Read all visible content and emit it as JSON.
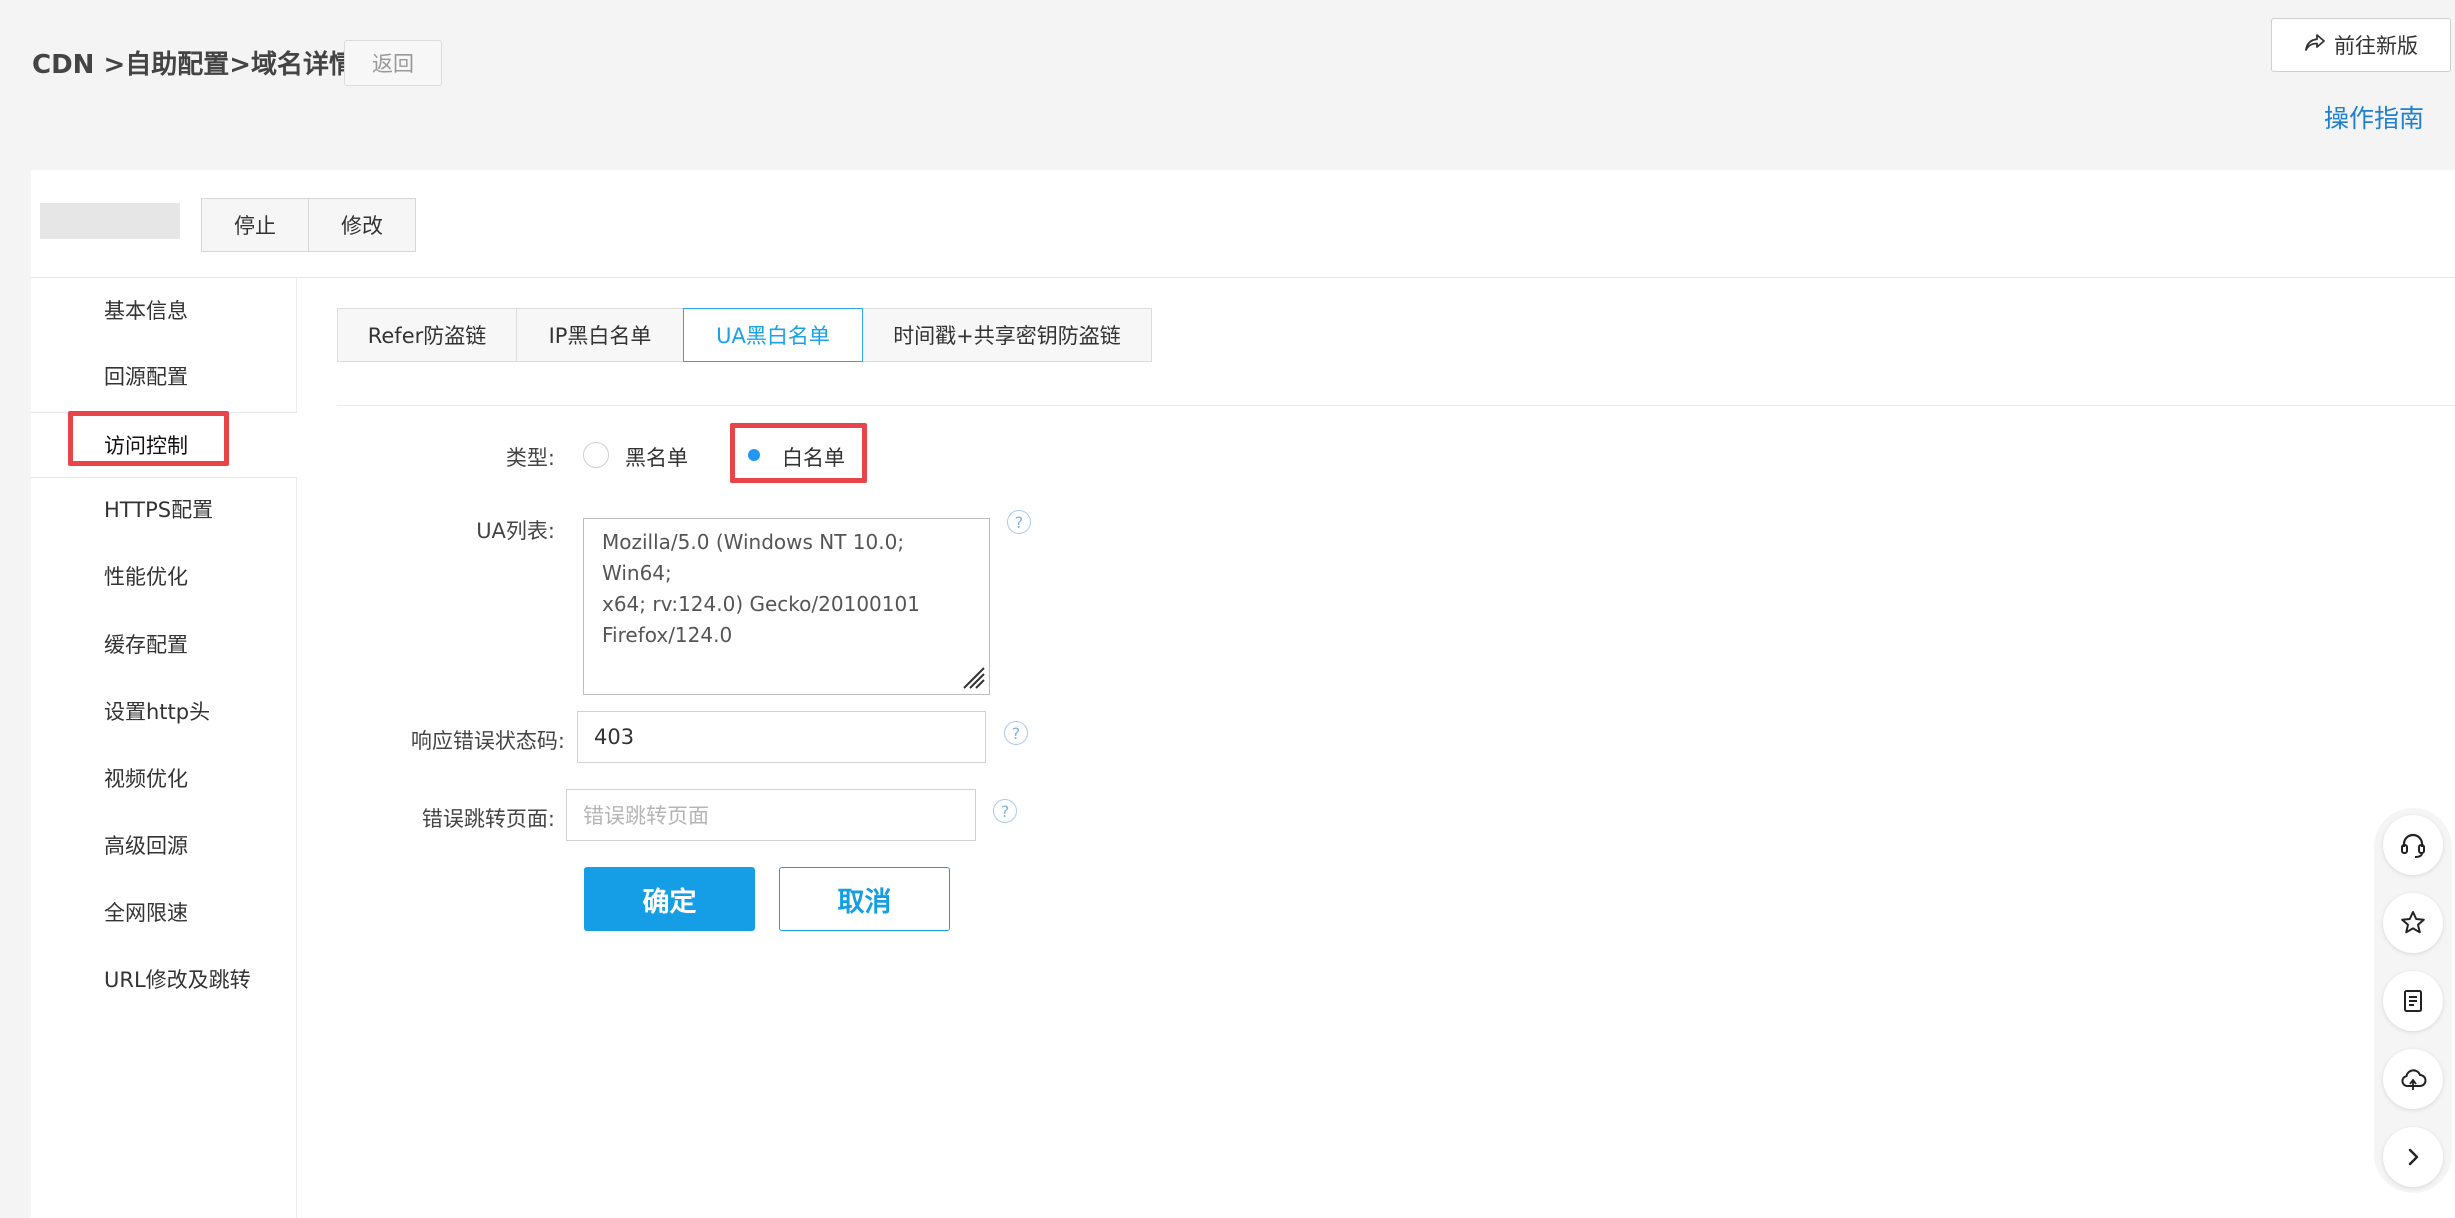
{
  "header": {
    "breadcrumb": "CDN >自助配置>域名详情",
    "back_label": "返回",
    "new_version_label": "前往新版",
    "guide_label": "操作指南"
  },
  "toolbar": {
    "stop_label": "停止",
    "edit_label": "修改"
  },
  "sidebar": {
    "items": [
      {
        "label": "基本信息"
      },
      {
        "label": "回源配置"
      },
      {
        "label": "访问控制",
        "active": true
      },
      {
        "label": "HTTPS配置"
      },
      {
        "label": "性能优化"
      },
      {
        "label": "缓存配置"
      },
      {
        "label": "设置http头"
      },
      {
        "label": "视频优化"
      },
      {
        "label": "高级回源"
      },
      {
        "label": "全网限速"
      },
      {
        "label": "URL修改及跳转"
      }
    ]
  },
  "tabs": [
    {
      "label": "Refer防盗链"
    },
    {
      "label": "IP黑白名单"
    },
    {
      "label": "UA黑白名单",
      "active": true
    },
    {
      "label": "时间戳+共享密钥防盗链"
    }
  ],
  "form": {
    "type_label": "类型:",
    "type_options": [
      {
        "label": "黑名单",
        "checked": false
      },
      {
        "label": "白名单",
        "checked": true
      }
    ],
    "ua_list_label": "UA列表:",
    "ua_list_value": "Mozilla/5.0 (Windows NT 10.0; Win64;\nx64; rv:124.0) Gecko/20100101\nFirefox/124.0",
    "status_code_label": "响应错误状态码:",
    "status_code_value": "403",
    "redirect_label": "错误跳转页面:",
    "redirect_placeholder": "错误跳转页面",
    "help_glyph": "?",
    "confirm_label": "确定",
    "cancel_label": "取消"
  },
  "float_toolbar": {
    "icons": [
      "headset-icon",
      "star-icon",
      "document-icon",
      "cloud-icon",
      "chevron-right-icon"
    ]
  },
  "colors": {
    "accent": "#159ee6",
    "link": "#1f7fd1",
    "highlight": "#e8454a",
    "radio_checked": "#2196f3"
  }
}
